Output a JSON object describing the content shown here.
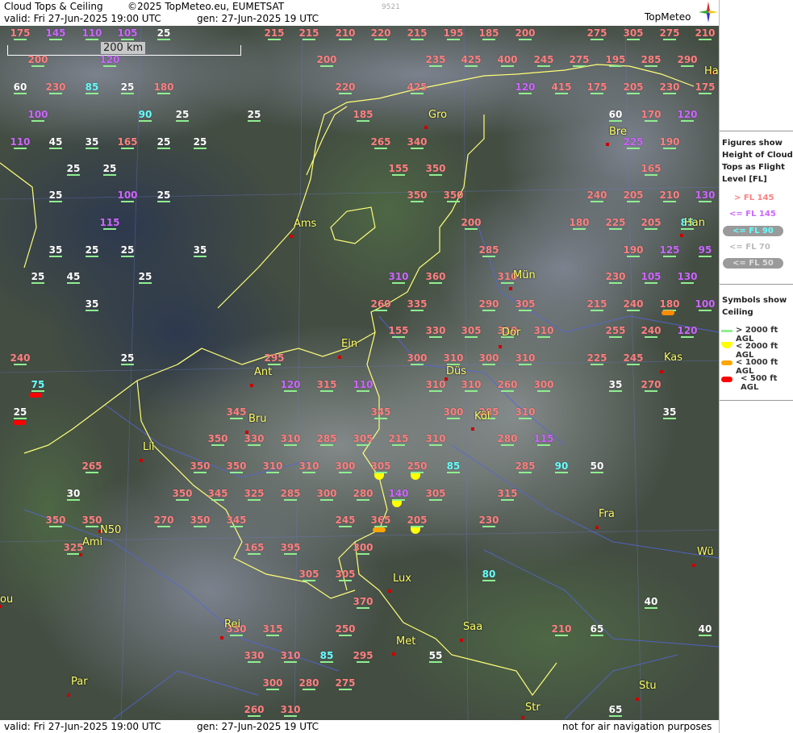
{
  "header": {
    "title": "Cloud Tops & Ceiling",
    "copyright": "©2025 TopMeteo.eu, EUMETSAT",
    "valid": "valid:  Fri  27-Jun-2025  19:00 UTC",
    "gen": "gen: 27-Jun-2025 19 UTC",
    "code": "9521",
    "logo": "TopMeteo"
  },
  "footer": {
    "valid": "valid:  Fri  27-Jun-2025  19:00 UTC",
    "gen": "gen: 27-Jun-2025 19 UTC",
    "note": "not for air navigation purposes"
  },
  "scale_label": "200 km",
  "legend": {
    "tops_title": [
      "Figures show",
      "Height of Cloud",
      "Tops as Flight",
      "Level  [FL]"
    ],
    "tops_items": [
      {
        "label": "> FL 145",
        "color": "#ff8080"
      },
      {
        "label": "<= FL 145",
        "color": "#cc66ff"
      },
      {
        "label": "<= FL 90",
        "color": "#66ffff"
      },
      {
        "label": "<= FL 70",
        "color": "#bbbbbb"
      },
      {
        "label": "<= FL 50",
        "color": "#dddddd"
      }
    ],
    "ceiling_title": [
      "Symbols show",
      "Ceiling"
    ],
    "ceiling_items": [
      {
        "label": "> 2000 ft AGL",
        "color": "#90ee90"
      },
      {
        "label": "< 2000 ft AGL",
        "color": "#ffff00"
      },
      {
        "label": "< 1000 ft AGL",
        "color": "#ffa500"
      },
      {
        "label": "< 500 ft AGL",
        "color": "#ff0000"
      }
    ]
  },
  "colors": {
    "high": "#ff8080",
    "mid": "#cc66ff",
    "low": "#66ffff",
    "vlow": "#ffffff",
    "city": "#ffff66"
  },
  "cities": [
    {
      "name": "Gro"
    },
    {
      "name": "Bre"
    },
    {
      "name": "Ams"
    },
    {
      "name": "Han"
    },
    {
      "name": "Ha"
    },
    {
      "name": "Mün"
    },
    {
      "name": "Dor"
    },
    {
      "name": "Ein"
    },
    {
      "name": "Kas"
    },
    {
      "name": "Ant"
    },
    {
      "name": "Düs"
    },
    {
      "name": "Köl"
    },
    {
      "name": "Bru"
    },
    {
      "name": "Lil"
    },
    {
      "name": "Fra"
    },
    {
      "name": "N50"
    },
    {
      "name": "Ami"
    },
    {
      "name": "Wü"
    },
    {
      "name": "Lux"
    },
    {
      "name": "ou"
    },
    {
      "name": "Rei"
    },
    {
      "name": "Saa"
    },
    {
      "name": "Met"
    },
    {
      "name": "Par"
    },
    {
      "name": "Stu"
    },
    {
      "name": "Str"
    }
  ],
  "labels": [
    {
      "v": "175",
      "c": "high"
    },
    {
      "v": "145",
      "c": "mid"
    },
    {
      "v": "110",
      "c": "mid"
    },
    {
      "v": "105",
      "c": "mid"
    },
    {
      "v": "25",
      "c": "vlow"
    },
    {
      "v": "215",
      "c": "high"
    },
    {
      "v": "215",
      "c": "high"
    },
    {
      "v": "210",
      "c": "high"
    },
    {
      "v": "220",
      "c": "high"
    },
    {
      "v": "215",
      "c": "high"
    },
    {
      "v": "195",
      "c": "high"
    },
    {
      "v": "185",
      "c": "high"
    },
    {
      "v": "200",
      "c": "high"
    },
    {
      "v": "275",
      "c": "high"
    },
    {
      "v": "305",
      "c": "high"
    },
    {
      "v": "275",
      "c": "high"
    },
    {
      "v": "210",
      "c": "high"
    },
    {
      "v": "200",
      "c": "high"
    },
    {
      "v": "120",
      "c": "mid"
    },
    {
      "v": "200",
      "c": "high"
    },
    {
      "v": "235",
      "c": "high"
    },
    {
      "v": "425",
      "c": "high"
    },
    {
      "v": "400",
      "c": "high"
    },
    {
      "v": "245",
      "c": "high"
    },
    {
      "v": "275",
      "c": "high"
    },
    {
      "v": "195",
      "c": "high"
    },
    {
      "v": "285",
      "c": "high"
    },
    {
      "v": "290",
      "c": "high"
    },
    {
      "v": "60",
      "c": "vlow"
    },
    {
      "v": "230",
      "c": "high"
    },
    {
      "v": "85",
      "c": "low"
    },
    {
      "v": "25",
      "c": "vlow"
    },
    {
      "v": "180",
      "c": "high"
    },
    {
      "v": "220",
      "c": "high"
    },
    {
      "v": "425",
      "c": "high"
    },
    {
      "v": "120",
      "c": "mid"
    },
    {
      "v": "415",
      "c": "high"
    },
    {
      "v": "175",
      "c": "high"
    },
    {
      "v": "205",
      "c": "high"
    },
    {
      "v": "230",
      "c": "high"
    },
    {
      "v": "175",
      "c": "high"
    },
    {
      "v": "100",
      "c": "mid"
    },
    {
      "v": "90",
      "c": "low"
    },
    {
      "v": "25",
      "c": "vlow"
    },
    {
      "v": "25",
      "c": "vlow"
    },
    {
      "v": "185",
      "c": "high"
    },
    {
      "v": "60",
      "c": "vlow"
    },
    {
      "v": "170",
      "c": "high"
    },
    {
      "v": "120",
      "c": "mid"
    },
    {
      "v": "110",
      "c": "mid"
    },
    {
      "v": "45",
      "c": "vlow"
    },
    {
      "v": "35",
      "c": "vlow"
    },
    {
      "v": "165",
      "c": "high"
    },
    {
      "v": "25",
      "c": "vlow"
    },
    {
      "v": "25",
      "c": "vlow"
    },
    {
      "v": "265",
      "c": "high"
    },
    {
      "v": "340",
      "c": "high"
    },
    {
      "v": "225",
      "c": "mid"
    },
    {
      "v": "190",
      "c": "high"
    },
    {
      "v": "25",
      "c": "vlow"
    },
    {
      "v": "25",
      "c": "vlow"
    },
    {
      "v": "155",
      "c": "high"
    },
    {
      "v": "350",
      "c": "high"
    },
    {
      "v": "165",
      "c": "high"
    },
    {
      "v": "25",
      "c": "vlow"
    },
    {
      "v": "100",
      "c": "mid"
    },
    {
      "v": "25",
      "c": "vlow"
    },
    {
      "v": "350",
      "c": "high"
    },
    {
      "v": "350",
      "c": "high"
    },
    {
      "v": "240",
      "c": "high"
    },
    {
      "v": "205",
      "c": "high"
    },
    {
      "v": "210",
      "c": "high"
    },
    {
      "v": "130",
      "c": "mid"
    },
    {
      "v": "115",
      "c": "mid"
    },
    {
      "v": "200",
      "c": "high"
    },
    {
      "v": "180",
      "c": "high"
    },
    {
      "v": "225",
      "c": "high"
    },
    {
      "v": "205",
      "c": "high"
    },
    {
      "v": "85",
      "c": "low"
    },
    {
      "v": "35",
      "c": "vlow"
    },
    {
      "v": "25",
      "c": "vlow"
    },
    {
      "v": "25",
      "c": "vlow"
    },
    {
      "v": "35",
      "c": "vlow"
    },
    {
      "v": "285",
      "c": "high"
    },
    {
      "v": "190",
      "c": "high"
    },
    {
      "v": "125",
      "c": "mid"
    },
    {
      "v": "95",
      "c": "mid"
    },
    {
      "v": "25",
      "c": "vlow"
    },
    {
      "v": "45",
      "c": "vlow"
    },
    {
      "v": "25",
      "c": "vlow"
    },
    {
      "v": "310",
      "c": "mid"
    },
    {
      "v": "360",
      "c": "high"
    },
    {
      "v": "310",
      "c": "high"
    },
    {
      "v": "230",
      "c": "high"
    },
    {
      "v": "105",
      "c": "mid"
    },
    {
      "v": "130",
      "c": "mid"
    },
    {
      "v": "35",
      "c": "vlow"
    },
    {
      "v": "260",
      "c": "high"
    },
    {
      "v": "335",
      "c": "high"
    },
    {
      "v": "290",
      "c": "high"
    },
    {
      "v": "305",
      "c": "high"
    },
    {
      "v": "215",
      "c": "high"
    },
    {
      "v": "240",
      "c": "high"
    },
    {
      "v": "180",
      "c": "high"
    },
    {
      "v": "100",
      "c": "mid"
    },
    {
      "v": "155",
      "c": "high"
    },
    {
      "v": "330",
      "c": "high"
    },
    {
      "v": "305",
      "c": "high"
    },
    {
      "v": "310",
      "c": "high"
    },
    {
      "v": "310",
      "c": "high"
    },
    {
      "v": "255",
      "c": "high"
    },
    {
      "v": "240",
      "c": "high"
    },
    {
      "v": "120",
      "c": "mid"
    },
    {
      "v": "240",
      "c": "high"
    },
    {
      "v": "25",
      "c": "vlow"
    },
    {
      "v": "295",
      "c": "high"
    },
    {
      "v": "300",
      "c": "high"
    },
    {
      "v": "310",
      "c": "high"
    },
    {
      "v": "300",
      "c": "high"
    },
    {
      "v": "310",
      "c": "high"
    },
    {
      "v": "225",
      "c": "high"
    },
    {
      "v": "245",
      "c": "high"
    },
    {
      "v": "75",
      "c": "low"
    },
    {
      "v": "120",
      "c": "mid"
    },
    {
      "v": "315",
      "c": "high"
    },
    {
      "v": "110",
      "c": "mid"
    },
    {
      "v": "310",
      "c": "high"
    },
    {
      "v": "310",
      "c": "high"
    },
    {
      "v": "260",
      "c": "high"
    },
    {
      "v": "300",
      "c": "high"
    },
    {
      "v": "35",
      "c": "vlow"
    },
    {
      "v": "270",
      "c": "high"
    },
    {
      "v": "25",
      "c": "vlow"
    },
    {
      "v": "345",
      "c": "high"
    },
    {
      "v": "345",
      "c": "high"
    },
    {
      "v": "300",
      "c": "high"
    },
    {
      "v": "285",
      "c": "high"
    },
    {
      "v": "310",
      "c": "high"
    },
    {
      "v": "35",
      "c": "vlow"
    },
    {
      "v": "350",
      "c": "high"
    },
    {
      "v": "330",
      "c": "high"
    },
    {
      "v": "310",
      "c": "high"
    },
    {
      "v": "285",
      "c": "high"
    },
    {
      "v": "305",
      "c": "high"
    },
    {
      "v": "215",
      "c": "high"
    },
    {
      "v": "310",
      "c": "high"
    },
    {
      "v": "280",
      "c": "high"
    },
    {
      "v": "115",
      "c": "mid"
    },
    {
      "v": "265",
      "c": "high"
    },
    {
      "v": "350",
      "c": "high"
    },
    {
      "v": "350",
      "c": "high"
    },
    {
      "v": "310",
      "c": "high"
    },
    {
      "v": "310",
      "c": "high"
    },
    {
      "v": "300",
      "c": "high"
    },
    {
      "v": "305",
      "c": "high"
    },
    {
      "v": "250",
      "c": "high"
    },
    {
      "v": "85",
      "c": "low"
    },
    {
      "v": "285",
      "c": "high"
    },
    {
      "v": "90",
      "c": "low"
    },
    {
      "v": "50",
      "c": "vlow"
    },
    {
      "v": "30",
      "c": "vlow"
    },
    {
      "v": "350",
      "c": "high"
    },
    {
      "v": "345",
      "c": "high"
    },
    {
      "v": "325",
      "c": "high"
    },
    {
      "v": "285",
      "c": "high"
    },
    {
      "v": "300",
      "c": "high"
    },
    {
      "v": "280",
      "c": "high"
    },
    {
      "v": "140",
      "c": "mid"
    },
    {
      "v": "305",
      "c": "high"
    },
    {
      "v": "315",
      "c": "high"
    },
    {
      "v": "350",
      "c": "high"
    },
    {
      "v": "350",
      "c": "high"
    },
    {
      "v": "270",
      "c": "high"
    },
    {
      "v": "350",
      "c": "high"
    },
    {
      "v": "345",
      "c": "high"
    },
    {
      "v": "245",
      "c": "high"
    },
    {
      "v": "365",
      "c": "high"
    },
    {
      "v": "205",
      "c": "high"
    },
    {
      "v": "230",
      "c": "high"
    },
    {
      "v": "325",
      "c": "high"
    },
    {
      "v": "165",
      "c": "high"
    },
    {
      "v": "395",
      "c": "high"
    },
    {
      "v": "300",
      "c": "high"
    },
    {
      "v": "305",
      "c": "high"
    },
    {
      "v": "305",
      "c": "high"
    },
    {
      "v": "80",
      "c": "low"
    },
    {
      "v": "370",
      "c": "high"
    },
    {
      "v": "40",
      "c": "vlow"
    },
    {
      "v": "330",
      "c": "high"
    },
    {
      "v": "315",
      "c": "high"
    },
    {
      "v": "250",
      "c": "high"
    },
    {
      "v": "210",
      "c": "high"
    },
    {
      "v": "65",
      "c": "vlow"
    },
    {
      "v": "40",
      "c": "vlow"
    },
    {
      "v": "330",
      "c": "high"
    },
    {
      "v": "310",
      "c": "high"
    },
    {
      "v": "85",
      "c": "low"
    },
    {
      "v": "295",
      "c": "high"
    },
    {
      "v": "55",
      "c": "vlow"
    },
    {
      "v": "300",
      "c": "high"
    },
    {
      "v": "280",
      "c": "high"
    },
    {
      "v": "275",
      "c": "high"
    },
    {
      "v": "260",
      "c": "high"
    },
    {
      "v": "310",
      "c": "high"
    },
    {
      "v": "65",
      "c": "vlow"
    }
  ],
  "symbols": [
    {
      "c": "#ff8c00"
    },
    {
      "c": "#ff0000"
    },
    {
      "c": "#ff0000"
    },
    {
      "c": "#ffff00"
    },
    {
      "c": "#ffff00"
    },
    {
      "c": "#ffff00"
    },
    {
      "c": "#ffa500"
    },
    {
      "c": "#ffff00"
    }
  ]
}
